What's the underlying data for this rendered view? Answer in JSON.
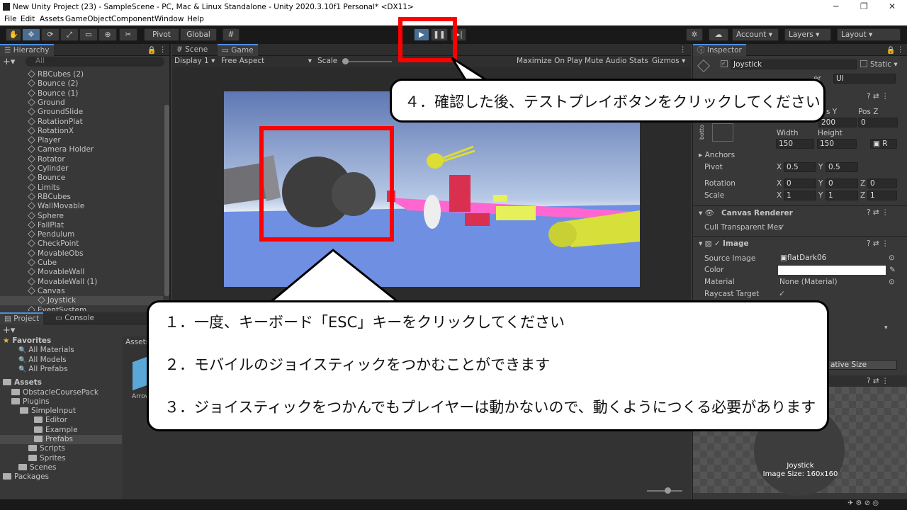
{
  "window": {
    "title": "New Unity Project (23) - SampleScene - PC, Mac & Linux Standalone - Unity 2020.3.10f1 Personal* <DX11>"
  },
  "menu": [
    "File",
    "Edit",
    "Assets",
    "GameObject",
    "Component",
    "Window",
    "Help"
  ],
  "toolbar": {
    "pivot": "Pivot",
    "global": "Global",
    "account": "Account",
    "layers": "Layers",
    "layout": "Layout"
  },
  "hierarchy": {
    "title": "Hierarchy",
    "search_placeholder": "All",
    "items": [
      "RBCubes (2)",
      "Bounce (2)",
      "Bounce (1)",
      "Ground",
      "GroundSlide",
      "RotationPlat",
      "RotationX",
      "Player",
      "Camera Holder",
      "Rotator",
      "Cylinder",
      "Bounce",
      "Limits",
      "RBCubes",
      "WallMovable",
      "Sphere",
      "FallPlat",
      "Pendulum",
      "CheckPoint",
      "MovableObs",
      "Cube",
      "MovableWall",
      "MovableWall (1)",
      "Canvas",
      "Joystick",
      "EventSystem"
    ]
  },
  "scene_tabs": {
    "scene": "Scene",
    "game": "Game"
  },
  "game_bar": {
    "display": "Display 1",
    "aspect": "Free Aspect",
    "scale": "Scale",
    "maximize": "Maximize On Play",
    "mute": "Mute Audio",
    "stats": "Stats",
    "gizmos": "Gizmos"
  },
  "project": {
    "tab_project": "Project",
    "tab_console": "Console",
    "favorites": "Favorites",
    "fav_items": [
      "All Materials",
      "All Models",
      "All Prefabs"
    ],
    "assets": "Assets",
    "tree": [
      "ObstacleCoursePack",
      "Plugins",
      "SimpleInput",
      "Editor",
      "Example",
      "Prefabs",
      "Scripts",
      "Sprites",
      "Scenes",
      "Packages"
    ],
    "breadcrumb": "Assets",
    "asset_label": "Arrow"
  },
  "inspector": {
    "title": "Inspector",
    "object_name": "Joystick",
    "static": "Static",
    "layer_label": "er",
    "layer_value": "UI",
    "pos_y_label": "s Y",
    "pos_z_label": "Pos Z",
    "pos_y_value": "200",
    "pos_z_value": "0",
    "width_label": "Width",
    "height_label": "Height",
    "width": "150",
    "height": "150",
    "anchor_side": "botto",
    "anchors": "Anchors",
    "pivot": "Pivot",
    "pivot_x": "0.5",
    "pivot_y": "0.5",
    "rotation": "Rotation",
    "rot_x": "0",
    "rot_y": "0",
    "rot_z": "0",
    "scale": "Scale",
    "scale_x": "1",
    "scale_y": "1",
    "scale_z": "1",
    "canvas_renderer": "Canvas Renderer",
    "cull": "Cull Transparent Mes",
    "image": "Image",
    "source_image": "Source Image",
    "source_value": "flatDark06",
    "color": "Color",
    "material": "Material",
    "material_value": "None (Material)",
    "raycast": "Raycast Target",
    "native_size": "ative Size",
    "preview_name": "Joystick",
    "preview_size": "Image Size: 160x160"
  },
  "annotations": {
    "top": "４．確認した後、テストプレイボタンをクリックしてください",
    "line1": "１．一度、キーボード「ESC」キーをクリックしてください",
    "line2": "２．モバイルのジョイスティックをつかむことができます",
    "line3": "３．ジョイスティックをつかんでもプレイヤーは動かないので、動くようにつくる必要があります"
  }
}
